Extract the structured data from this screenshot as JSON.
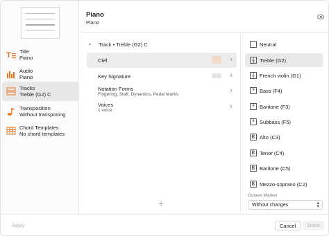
{
  "header": {
    "title": "Piano",
    "subtitle": "Piano"
  },
  "sidebar": {
    "items": [
      {
        "label": "Title",
        "value": "Piano",
        "icon": "title-icon"
      },
      {
        "label": "Audio",
        "value": "Piano",
        "icon": "audio-icon"
      },
      {
        "label": "Tracks",
        "value": "Treble (G2) C",
        "icon": "tracks-icon"
      },
      {
        "label": "Transposition",
        "value": "Without transposing",
        "icon": "transposition-icon"
      },
      {
        "label": "Chord Templates",
        "value": "No chord templates",
        "icon": "chord-templates-icon"
      }
    ]
  },
  "middle": {
    "track_label": "Track • Treble (G2) C",
    "props": [
      {
        "label": "Clef"
      },
      {
        "label": "Key Signature"
      },
      {
        "label": "Notation Forms",
        "detail": "Fingering, Staff, Dynamics, Pedal Marks"
      },
      {
        "label": "Voices",
        "detail": "1 voice"
      }
    ],
    "add_symbol": "+"
  },
  "clef_options": [
    "Neutral",
    "Treble (G2)",
    "French violin (G1)",
    "Bass (F4)",
    "Baritone (F3)",
    "Subbass (F5)",
    "Alto (C3)",
    "Tenor (C4)",
    "Baritone (C5)",
    "Mezzo-soprano (C2)"
  ],
  "clef_icons": [
    "",
    "𝄞",
    "𝄞",
    "𝄢",
    "𝄢",
    "𝄢",
    "𝄡",
    "𝄡",
    "𝄡",
    "𝄡"
  ],
  "octave": {
    "label": "Octave Marker",
    "value": "Without changes"
  },
  "footer": {
    "apply": "Apply",
    "cancel": "Cancel",
    "done": "Done"
  },
  "colors": {
    "accent": "#e8741f",
    "selected_bg": "#e8e8e8"
  }
}
